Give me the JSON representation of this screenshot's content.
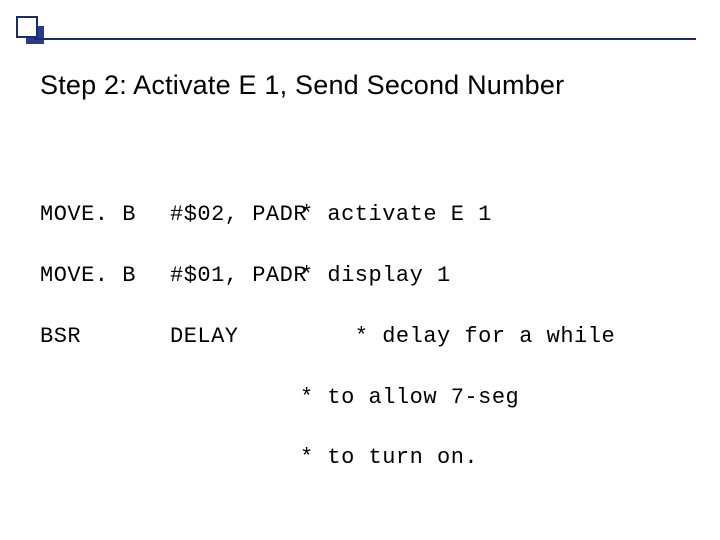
{
  "slide": {
    "title": "Step 2: Activate E 1, Send Second Number"
  },
  "code": {
    "l1": {
      "inst": "MOVE. B",
      "op": "#$02, PADR",
      "comment": "* activate E 1"
    },
    "l2": {
      "inst": "MOVE. B",
      "op": "#$01, PADR",
      "comment": "* display 1"
    },
    "l3": {
      "inst": "BSR",
      "op": "DELAY",
      "comment": "    * delay for a while"
    },
    "l4": {
      "comment": "* to allow 7-seg"
    },
    "l5": {
      "comment": "* to turn on."
    }
  }
}
